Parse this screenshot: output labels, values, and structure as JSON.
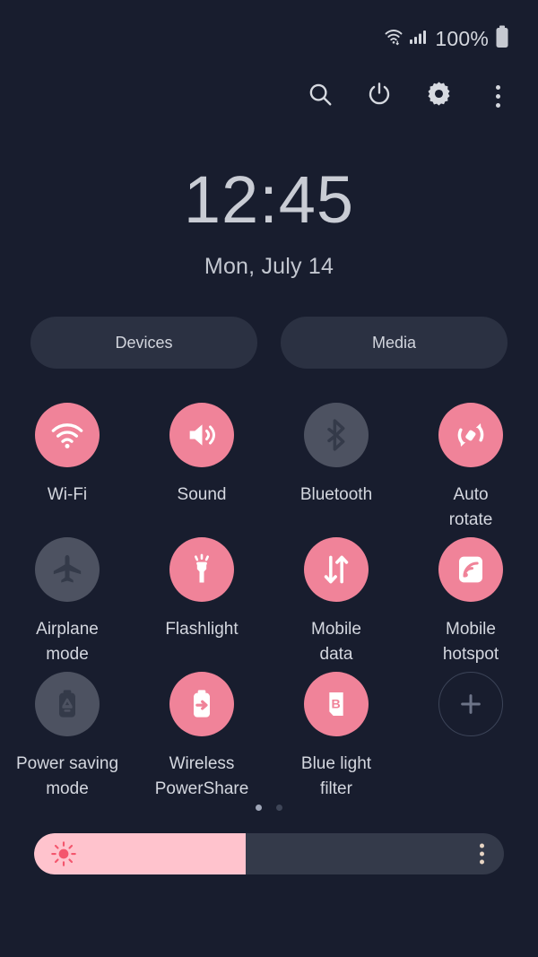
{
  "status_bar": {
    "wifi_icon": "wifi-icon",
    "signal_icon": "cellular-signal-icon",
    "battery_percent": "100%",
    "battery_icon": "battery-full-icon"
  },
  "toolbar": {
    "search_icon": "search-icon",
    "power_icon": "power-icon",
    "settings_icon": "gear-icon",
    "more_icon": "overflow-menu-icon"
  },
  "clock": {
    "time": "12:45",
    "date": "Mon, July 14"
  },
  "shortcuts": {
    "devices_label": "Devices",
    "media_label": "Media"
  },
  "toggles": [
    {
      "label": "Wi-Fi",
      "icon": "wifi-icon",
      "state": "on"
    },
    {
      "label": "Sound",
      "icon": "volume-icon",
      "state": "on"
    },
    {
      "label": "Bluetooth",
      "icon": "bluetooth-icon",
      "state": "off"
    },
    {
      "label": "Auto\nrotate",
      "icon": "auto-rotate-icon",
      "state": "on"
    },
    {
      "label": "Airplane\nmode",
      "icon": "airplane-icon",
      "state": "off"
    },
    {
      "label": "Flashlight",
      "icon": "flashlight-icon",
      "state": "on"
    },
    {
      "label": "Mobile\ndata",
      "icon": "mobile-data-icon",
      "state": "on"
    },
    {
      "label": "Mobile\nhotspot",
      "icon": "hotspot-icon",
      "state": "on"
    },
    {
      "label": "Power saving\nmode",
      "icon": "power-saving-icon",
      "state": "off"
    },
    {
      "label": "Wireless\nPowerShare",
      "icon": "power-share-icon",
      "state": "on"
    },
    {
      "label": "Blue light\nfilter",
      "icon": "blue-light-icon",
      "state": "on"
    },
    {
      "label": "",
      "icon": "add-icon",
      "state": "add"
    }
  ],
  "pagination": {
    "total_pages": 2,
    "current_page": 1
  },
  "brightness": {
    "icon": "brightness-sun-icon",
    "value_percent": 45,
    "menu_icon": "overflow-menu-icon"
  },
  "colors": {
    "background": "#181d2e",
    "accent_on": "#f08399",
    "toggle_off": "#4d5261",
    "pill_bg": "#2b3142",
    "slider_track": "#343a4a",
    "slider_fill": "#ffc3cd",
    "text_primary": "#d4d7df"
  }
}
